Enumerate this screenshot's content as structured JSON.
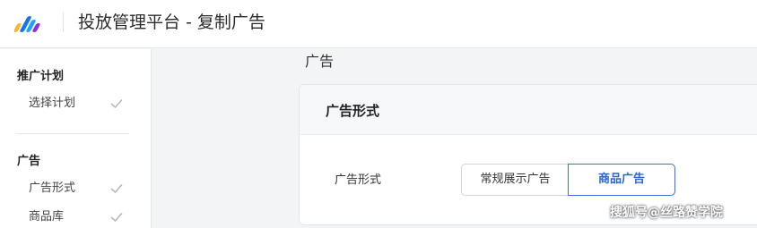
{
  "header": {
    "title": "投放管理平台 - 复制广告",
    "logo_colors": [
      "#f7b733",
      "#1a73e8",
      "#1aa3ff",
      "#8e2de2"
    ]
  },
  "sidebar": {
    "groups": [
      {
        "title": "推广计划",
        "items": [
          {
            "label": "选择计划",
            "icon": "check-icon"
          }
        ]
      },
      {
        "title": "广告",
        "items": [
          {
            "label": "广告形式",
            "icon": "check-icon"
          },
          {
            "label": "商品库",
            "icon": "check-icon"
          }
        ]
      }
    ]
  },
  "main": {
    "section_title": "广告",
    "card": {
      "title": "广告形式",
      "field_label": "广告形式",
      "options": [
        {
          "label": "常规展示广告",
          "selected": false
        },
        {
          "label": "商品广告",
          "selected": true
        }
      ]
    }
  },
  "watermark": "搜狐号@丝路赞学院",
  "colors": {
    "accent": "#2d64d8",
    "check": "#b8b8b8"
  }
}
